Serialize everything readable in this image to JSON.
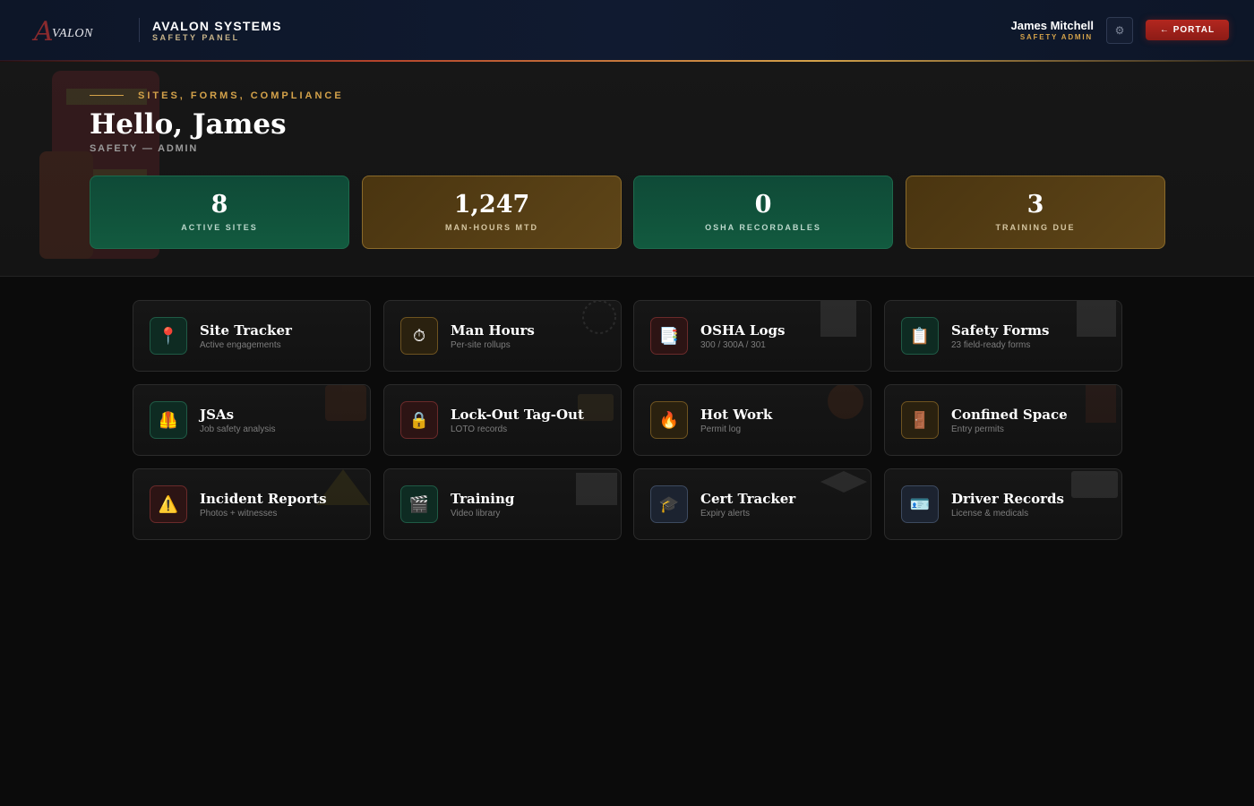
{
  "header": {
    "logo_letter": "A",
    "logo_word": "VALON",
    "brand_title": "AVALON SYSTEMS",
    "brand_subtitle": "SAFETY PANEL",
    "user_name": "James Mitchell",
    "user_role": "SAFETY ADMIN",
    "settings_icon": "gear-icon",
    "portal_label": "← PORTAL"
  },
  "hero": {
    "eyebrow": "SITES, FORMS, COMPLIANCE",
    "greeting": "Hello, James",
    "role_line": "SAFETY — ADMIN",
    "stats": [
      {
        "value": "8",
        "label": "ACTIVE SITES"
      },
      {
        "value": "1,247",
        "label": "MAN-HOURS MTD"
      },
      {
        "value": "0",
        "label": "OSHA RECORDABLES"
      },
      {
        "value": "3",
        "label": "TRAINING DUE"
      }
    ]
  },
  "tiles": [
    {
      "title": "Site Tracker",
      "subtitle": "Active engagements",
      "icon": "📍",
      "icon_name": "map-pin-icon"
    },
    {
      "title": "Man Hours",
      "subtitle": "Per-site rollups",
      "icon": "⏱",
      "icon_name": "stopwatch-icon"
    },
    {
      "title": "OSHA Logs",
      "subtitle": "300 / 300A / 301",
      "icon": "📑",
      "icon_name": "document-icon"
    },
    {
      "title": "Safety Forms",
      "subtitle": "23 field-ready forms",
      "icon": "📋",
      "icon_name": "clipboard-icon"
    },
    {
      "title": "JSAs",
      "subtitle": "Job safety analysis",
      "icon": "🦺",
      "icon_name": "safety-vest-icon"
    },
    {
      "title": "Lock-Out Tag-Out",
      "subtitle": "LOTO records",
      "icon": "🔒",
      "icon_name": "padlock-icon"
    },
    {
      "title": "Hot Work",
      "subtitle": "Permit log",
      "icon": "🔥",
      "icon_name": "fire-icon"
    },
    {
      "title": "Confined Space",
      "subtitle": "Entry permits",
      "icon": "🚪",
      "icon_name": "door-icon"
    },
    {
      "title": "Incident Reports",
      "subtitle": "Photos + witnesses",
      "icon": "⚠️",
      "icon_name": "warning-icon"
    },
    {
      "title": "Training",
      "subtitle": "Video library",
      "icon": "🎬",
      "icon_name": "clapperboard-icon"
    },
    {
      "title": "Cert Tracker",
      "subtitle": "Expiry alerts",
      "icon": "🎓",
      "icon_name": "graduation-cap-icon"
    },
    {
      "title": "Driver Records",
      "subtitle": "License & medicals",
      "icon": "🪪",
      "icon_name": "id-card-icon"
    }
  ],
  "colors": {
    "accent_gold": "#d4a24a",
    "accent_red": "#b3271f",
    "stat_green": "#125a3f",
    "stat_gold": "#5e4518",
    "header_bg": "#0d1628"
  }
}
